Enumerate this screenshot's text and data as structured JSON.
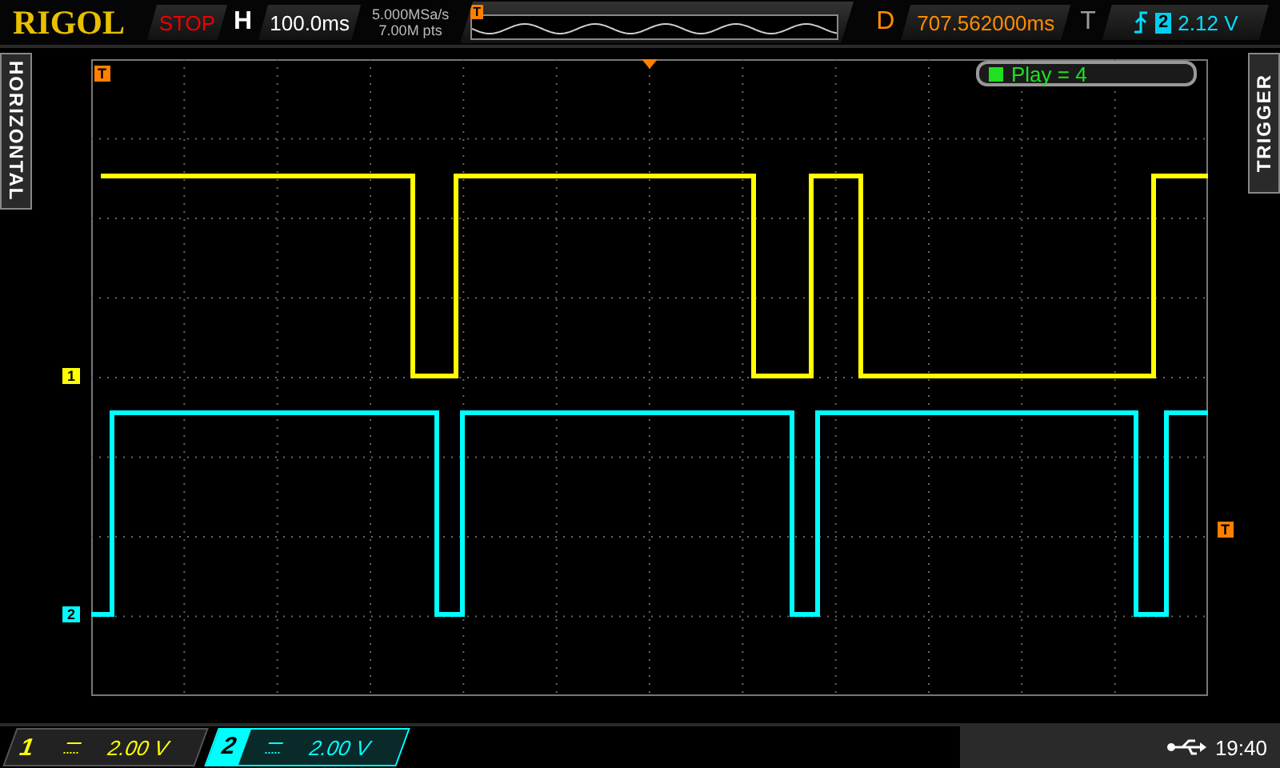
{
  "brand": "RIGOL",
  "run_state": "STOP",
  "horizontal": {
    "label": "H",
    "timebase": "100.0ms",
    "position_marker": "T",
    "overview_marker": "T"
  },
  "acquisition": {
    "sample_rate": "5.000MSa/s",
    "memory_depth": "7.00M pts"
  },
  "delay": {
    "label": "D",
    "value": "707.562000ms"
  },
  "trigger": {
    "label": "T",
    "source": "2",
    "level": "2.12 V",
    "level_marker": "T"
  },
  "side_tabs": [
    {
      "label": "HORIZONTAL"
    },
    {
      "label": "TRIGGER"
    }
  ],
  "playback": {
    "text": "Play = 4"
  },
  "channels": [
    {
      "number": "1",
      "level_marker": "1",
      "scale": "2.00 V",
      "selected": false,
      "color": "#ffff00"
    },
    {
      "number": "2",
      "level_marker": "2",
      "scale": "2.00 V",
      "selected": true,
      "color": "#00ffff"
    }
  ],
  "status": {
    "time": "19:40"
  }
}
